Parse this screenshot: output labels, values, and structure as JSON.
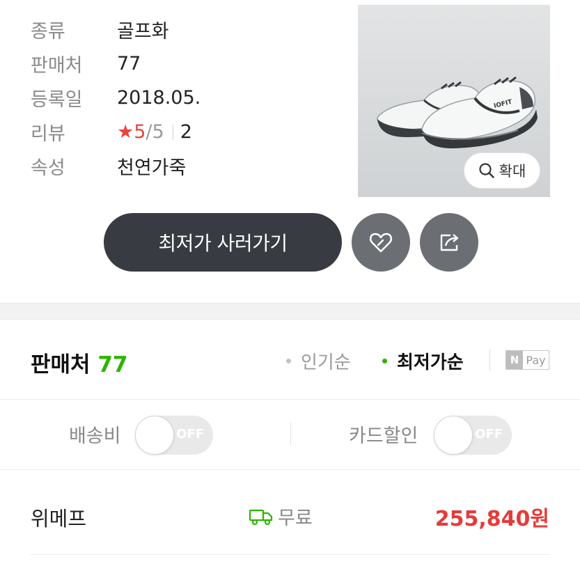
{
  "product_info": {
    "rows": [
      {
        "label": "종류",
        "value": "골프화"
      },
      {
        "label": "판매처",
        "value": "77"
      },
      {
        "label": "등록일",
        "value": "2018.05."
      },
      {
        "label": "리뷰",
        "value": ""
      },
      {
        "label": "속성",
        "value": "천연가죽"
      }
    ],
    "review": {
      "star": "★",
      "score": "5",
      "separator": "/",
      "max": "5",
      "count": "2"
    }
  },
  "image": {
    "zoom_label": "확대",
    "brand_text": "IOFIT",
    "icons": {
      "zoom": "magnifier-icon"
    }
  },
  "actions": {
    "buy_label": "최저가 사러가기",
    "wishlist_icon": "heart-icon",
    "share_icon": "share-icon"
  },
  "sellers": {
    "title": "판매처",
    "count": "77",
    "sort_popular": "인기순",
    "sort_lowest": "최저가순",
    "npay_badge": "N",
    "npay_text": "Pay"
  },
  "filters": {
    "shipping_label": "배송비",
    "shipping_toggle": "OFF",
    "card_label": "카드할인",
    "card_toggle": "OFF"
  },
  "offers": [
    {
      "store": "위메프",
      "shipping": "무료",
      "price": "255,840원"
    }
  ],
  "colors": {
    "accent_green": "#2db400",
    "price_red": "#e53b3b",
    "button_dark": "#383b42",
    "button_gray": "#6b6e73"
  }
}
